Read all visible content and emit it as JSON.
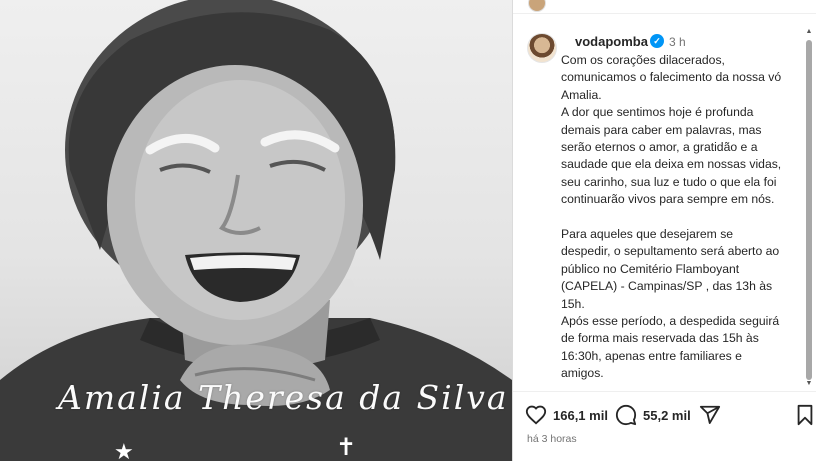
{
  "photo": {
    "signature": "Amalia Theresa da Silva",
    "star_glyph": "★",
    "cross_glyph": "✝"
  },
  "post": {
    "username": "vodapomba",
    "verified_mark": "✓",
    "time": "3 h",
    "caption": [
      "Com os corações dilacerados, comunicamos o falecimento da nossa vó Amalia.",
      "A dor que sentimos hoje é profunda demais para caber em palavras, mas serão eternos o amor, a gratidão e a saudade que ela deixa em nossas vidas, seu carinho, sua luz e tudo o que ela foi continuarão vivos para sempre em nós.",
      "",
      "Para aqueles que desejarem se despedir, o sepultamento será aberto ao público no Cemitério Flamboyant (CAPELA) - Campinas/SP , das 13h às 15h.",
      "Após esse período, a despedida seguirá de forma mais reservada das 15h às 16:30h, apenas entre familiares e amigos."
    ],
    "likes": "166,1 mil",
    "comments": "55,2 mil",
    "posted_ago": "há 3 horas"
  },
  "icons": {
    "like": "heart-icon",
    "comment": "comment-bubble-icon",
    "share": "paper-plane-icon",
    "save": "bookmark-icon",
    "verified": "verified-badge-icon"
  },
  "colors": {
    "verified_blue": "#0095f6",
    "text": "#262626",
    "muted": "#737373"
  }
}
